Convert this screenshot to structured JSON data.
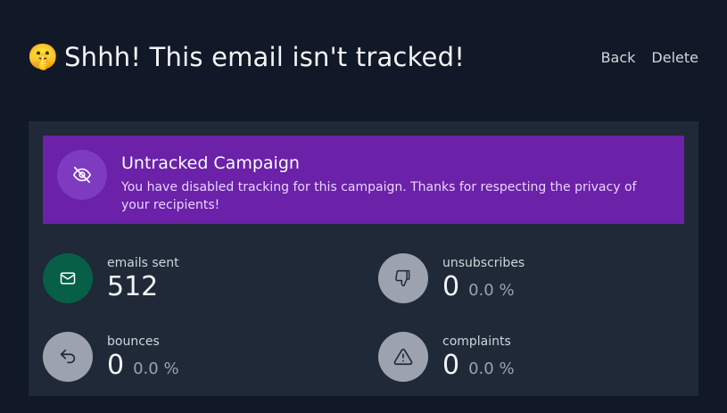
{
  "header": {
    "emoji": "🤫",
    "title": "Shhh! This email isn't tracked!",
    "back_label": "Back",
    "delete_label": "Delete"
  },
  "banner": {
    "icon": "eye-slash-icon",
    "title": "Untracked Campaign",
    "description": "You have disabled tracking for this campaign. Thanks for respecting the privacy of your recipients!",
    "color": "#6b21a8"
  },
  "stats": {
    "emails_sent": {
      "label": "emails sent",
      "value": "512",
      "icon": "envelope-icon",
      "color": "#065f46"
    },
    "unsubscribes": {
      "label": "unsubscribes",
      "value": "0",
      "percent": "0.0 %",
      "icon": "thumbs-down-icon",
      "color": "#9ca3af"
    },
    "bounces": {
      "label": "bounces",
      "value": "0",
      "percent": "0.0 %",
      "icon": "reply-arrow-icon",
      "color": "#9ca3af"
    },
    "complaints": {
      "label": "complaints",
      "value": "0",
      "percent": "0.0 %",
      "icon": "warning-triangle-icon",
      "color": "#9ca3af"
    }
  }
}
